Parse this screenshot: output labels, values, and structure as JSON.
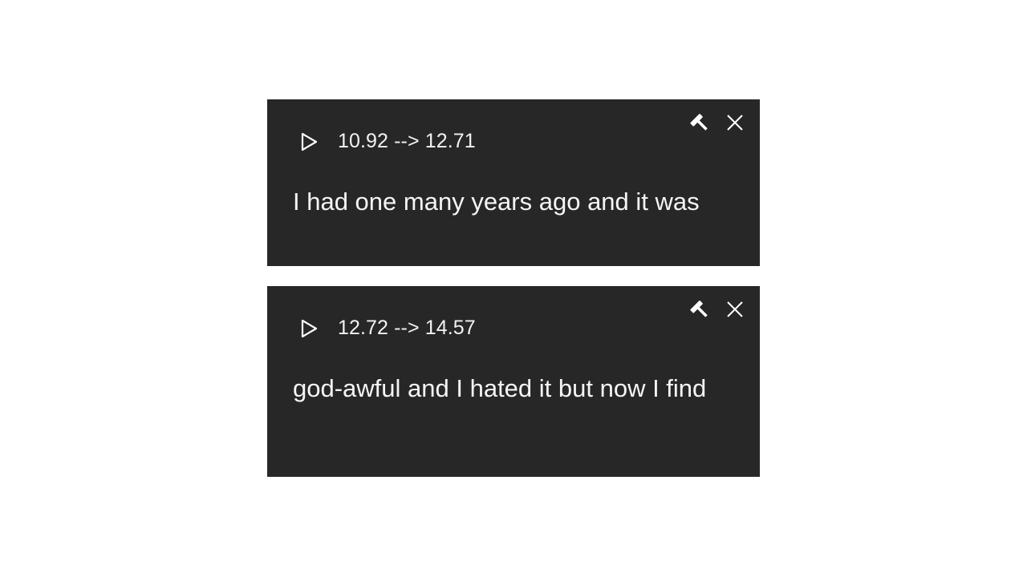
{
  "cues": [
    {
      "time_range": "10.92 --> 12.71",
      "text": "I had one many years ago and it was",
      "play_icon": "play-icon",
      "hammer_icon": "hammer-icon",
      "close_icon": "close-icon"
    },
    {
      "time_range": "12.72 --> 14.57",
      "text": "god-awful and I hated it but now I find",
      "play_icon": "play-icon",
      "hammer_icon": "hammer-icon",
      "close_icon": "close-icon"
    }
  ],
  "colors": {
    "card_background": "#272727",
    "text": "#f2f2f2",
    "page_background": "#ffffff"
  }
}
